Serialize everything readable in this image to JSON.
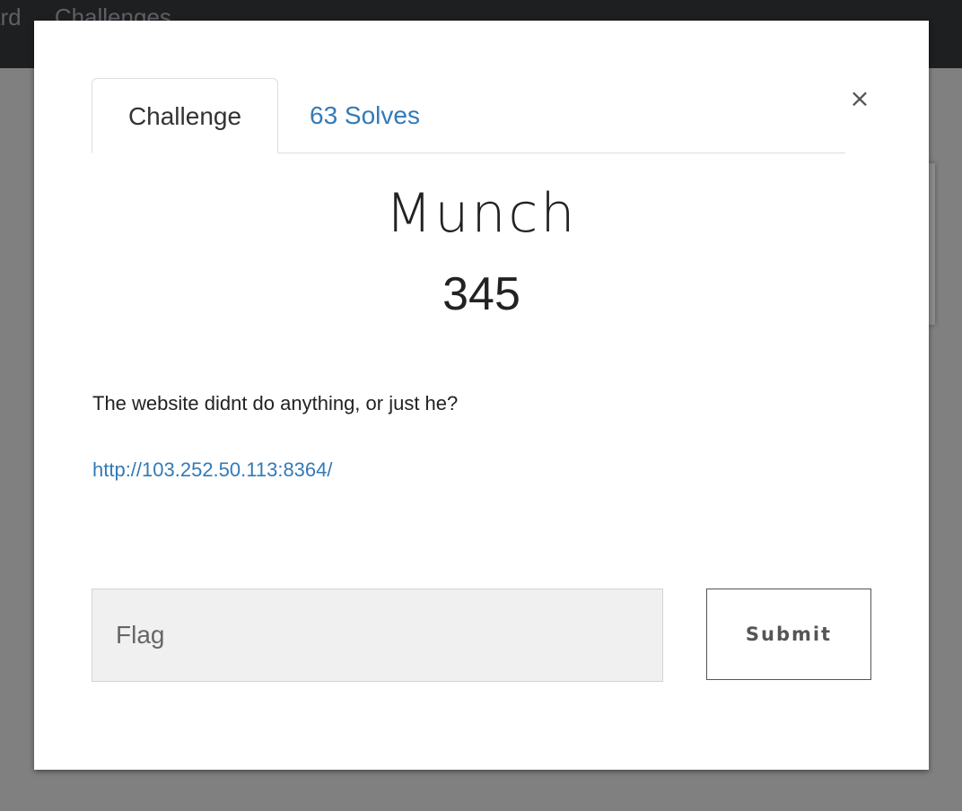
{
  "nav": {
    "item_partial_left": "ard",
    "item_partial_right": "Challenges"
  },
  "modal": {
    "close_symbol": "×",
    "tabs": [
      {
        "label": "Challenge",
        "active": true
      },
      {
        "label": "63 Solves",
        "active": false
      }
    ],
    "challenge": {
      "name": "Munch",
      "points": "345",
      "description": "The website didnt do anything, or just he?",
      "link": "http://103.252.50.113:8364/"
    },
    "form": {
      "flag_placeholder": "Flag",
      "flag_value": "",
      "submit_label": "Submit"
    }
  },
  "colors": {
    "link": "#337ab7",
    "overlay": "#808080",
    "navbar": "#1d1f21"
  }
}
